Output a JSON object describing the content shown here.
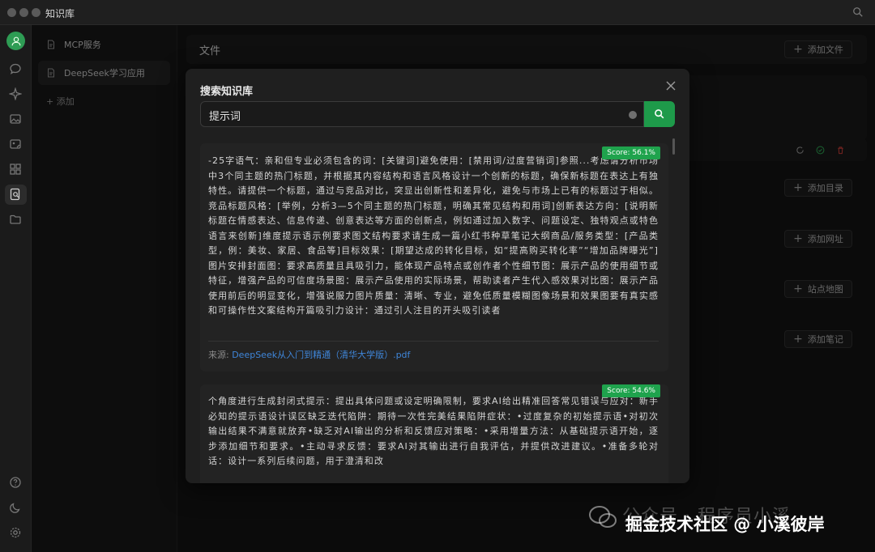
{
  "window": {
    "title": "知识库"
  },
  "rail": {
    "icons": [
      "avatar-icon",
      "chat-icon",
      "sparkle-icon",
      "image-icon",
      "image-edit-icon",
      "grid-icon",
      "knowledge-base-icon",
      "folder-icon",
      "help-icon",
      "moon-icon",
      "settings-icon"
    ]
  },
  "kb_sidebar": {
    "items": [
      {
        "label": "MCP服务",
        "active": false
      },
      {
        "label": "DeepSeek学习应用",
        "active": true
      }
    ],
    "add_label": "添加"
  },
  "main": {
    "files_title": "文件",
    "add_file": "添加文件",
    "add_directory": "添加目录",
    "add_url": "添加网址",
    "sitemap": "站点地图",
    "add_note": "添加笔记"
  },
  "modal": {
    "title": "搜索知识库",
    "query": "提示词",
    "results": [
      {
        "score": "Score: 56.1%",
        "text": "-25字语气：亲和但专业必须包含的词：[关键词]避免使用：[禁用词/过度营销词]参照...考虑请分析市场中3个同主题的热门标题，并根据其内容结构和语言风格设计一个创新的标题，确保新标题在表达上有独特性。请提供一个标题，通过与竞品对比，突显出创新性和差异化，避免与市场上已有的标题过于相似。竞品标题风格：[举例，分析3—5个同主题的热门标题，明确其常见结构和用词]创新表达方向：[说明新标题在情感表达、信息传递、创意表达等方面的创新点，例如通过加入数字、问题设定、独特观点或特色语言来创新]维度提示语示例要求图文结构要求请生成一篇小红书种草笔记大纲商品/服务类型：[产品类型，例：美妆、家居、食品等]目标效果：[期望达成的转化目标，如“提高购买转化率”“增加品牌曝光”]图片安排封面图：要求高质量且具吸引力，能体现产品特点或创作者个性细节图：展示产品的使用细节或特征，增强产品的可信度场景图：展示产品使用的实际场景，帮助读者产生代入感效果对比图：展示产品使用前后的明显变化，增强说服力图片质量：清晰、专业，避免低质量模糊图像场景和效果图要有真实感和可操作性文案结构开篇吸引力设计：通过引人注目的开头吸引读者",
        "source_label": "来源: ",
        "source_file": "DeepSeek从入门到精通（清华大学版）.pdf"
      },
      {
        "score": "Score: 54.6%",
        "text": "个角度进行生成封闭式提示：提出具体问题或设定明确限制，要求AI给出精准回答常见错误与应对：新手必知的提示语设计误区缺乏迭代陷阱：期待一次性完美结果陷阱症状：•过度复杂的初始提示语•对初次输出结果不满意就放弃•缺乏对AI输出的分析和反馈应对策略：•采用增量方法：从基础提示语开始，逐步添加细节和要求。•主动寻求反馈：要求AI对其输出进行自我评估，并提供改进建议。•准备多轮对话：设计一系列后续问题，用于澄清和改"
      }
    ]
  },
  "watermark": {
    "line1": "公众号 · 程序员小溪",
    "line2": "掘金技术社区 @ 小溪彼岸"
  }
}
